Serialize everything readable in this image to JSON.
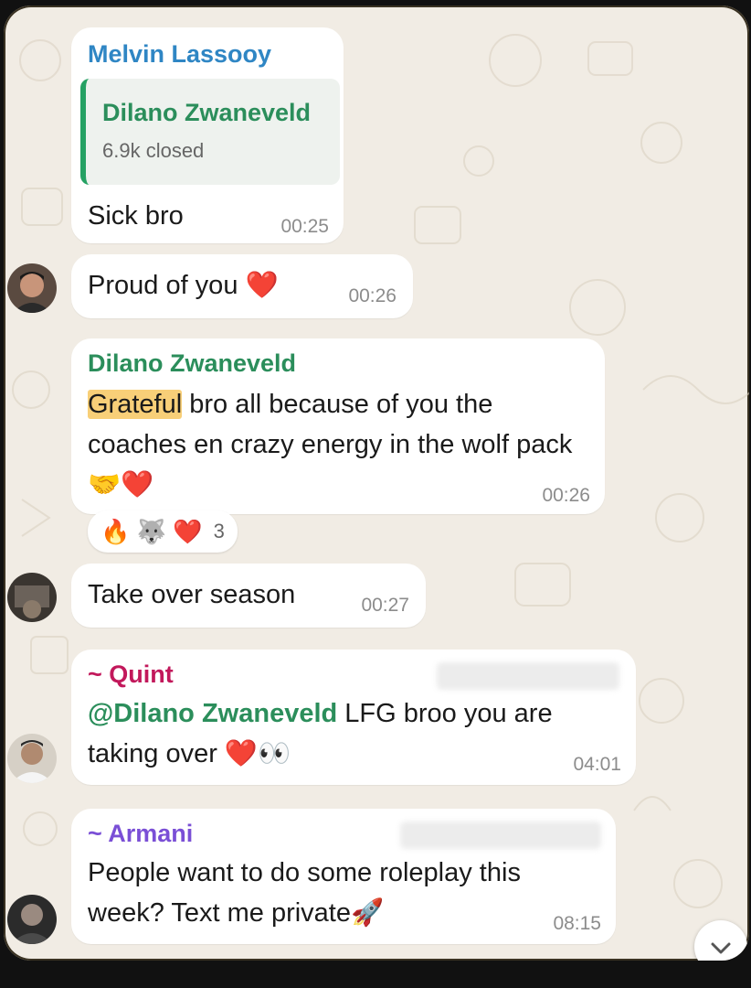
{
  "colors": {
    "chat_background": "#f1ece4",
    "bubble": "#ffffff",
    "sender_blue": "#2f86c4",
    "sender_green": "#2b8e5b",
    "sender_red": "#c2185b",
    "sender_purple": "#7a4fd6",
    "quote_bar": "#25a163",
    "highlight": "#f8cf78",
    "timestamp": "#8c8c8c"
  },
  "messages": [
    {
      "sender": "Melvin Lassooy",
      "quote": {
        "author": "Dilano Zwaneveld",
        "text": "6.9k closed"
      },
      "text": "Sick bro",
      "time": "00:25"
    },
    {
      "avatar": "user-avatar-photo",
      "text": "Proud of you ❤️",
      "time": "00:26"
    },
    {
      "sender": "Dilano Zwaneveld",
      "highlight_word": "Grateful",
      "text_rest": " bro all because of you the coaches en crazy energy in the wolf pack 🤝❤️",
      "time": "00:26",
      "reactions": {
        "emojis": "🔥 🐺 ❤️",
        "count": "3"
      }
    },
    {
      "avatar": "user-avatar-photo",
      "text": "Take over season",
      "time": "00:27"
    },
    {
      "sender": "~ Quint",
      "mention": "@Dilano Zwaneveld",
      "text_rest": " LFG broo you are taking over ❤️👀",
      "time": "04:01"
    },
    {
      "sender": "~ Armani",
      "text": "People want to do some roleplay this week? Text me private🚀",
      "time": "08:15"
    }
  ],
  "scroll_button_icon": "chevron-down-icon"
}
